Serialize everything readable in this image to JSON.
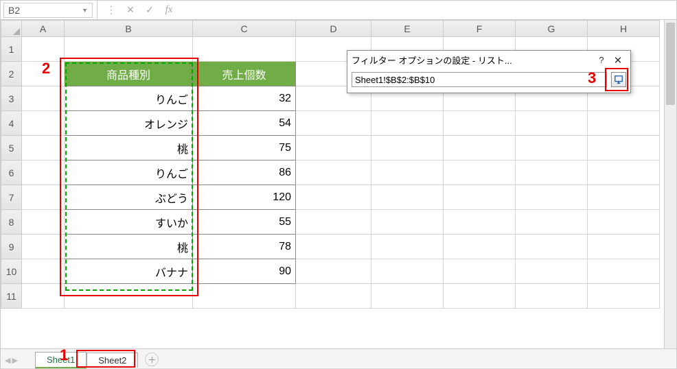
{
  "nameBox": "B2",
  "formulaBar": "",
  "columns": [
    "A",
    "B",
    "C",
    "D",
    "E",
    "F",
    "G",
    "H"
  ],
  "rows": [
    "1",
    "2",
    "3",
    "4",
    "5",
    "6",
    "7",
    "8",
    "9",
    "10",
    "11"
  ],
  "headers": {
    "b": "商品種別",
    "c": "売上個数"
  },
  "data_b": [
    "りんご",
    "オレンジ",
    "桃",
    "りんご",
    "ぶどう",
    "すいか",
    "桃",
    "バナナ"
  ],
  "data_c": [
    "32",
    "54",
    "75",
    "86",
    "120",
    "55",
    "78",
    "90"
  ],
  "dialog": {
    "title": "フィルター オプションの設定 - リスト...",
    "help": "?",
    "close": "✕",
    "value": "Sheet1!$B$2:$B$10"
  },
  "tabs": {
    "t1": "Sheet1",
    "t2": "Sheet2"
  },
  "callouts": {
    "n1": "1",
    "n2": "2",
    "n3": "3"
  }
}
